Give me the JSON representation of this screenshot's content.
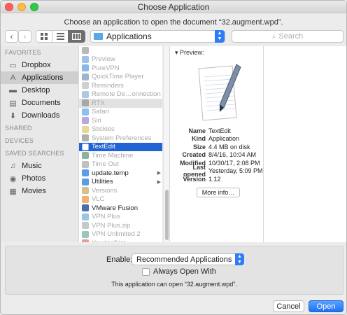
{
  "window": {
    "title": "Choose Application",
    "prompt": "Choose an application to open the document “32.augment.wpd”."
  },
  "toolbar": {
    "location": "Applications",
    "search_placeholder": "Search"
  },
  "sidebar": {
    "sections": [
      {
        "header": "FAVORITES",
        "items": [
          {
            "label": "Dropbox",
            "icon": "dropbox-icon"
          },
          {
            "label": "Applications",
            "icon": "applications-icon",
            "selected": true
          },
          {
            "label": "Desktop",
            "icon": "desktop-icon"
          },
          {
            "label": "Documents",
            "icon": "documents-icon"
          },
          {
            "label": "Downloads",
            "icon": "downloads-icon"
          }
        ]
      },
      {
        "header": "SHARED",
        "items": []
      },
      {
        "header": "DEVICES",
        "items": []
      },
      {
        "header": "SAVED SEARCHES",
        "items": [
          {
            "label": "Music",
            "icon": "music-icon"
          },
          {
            "label": "Photos",
            "icon": "photos-icon"
          },
          {
            "label": "Movies",
            "icon": "movies-icon"
          }
        ]
      }
    ]
  },
  "apps": [
    {
      "label": "",
      "color": "#b9b9b9"
    },
    {
      "label": "Preview",
      "color": "#9ec3e6"
    },
    {
      "label": "PureVPN",
      "color": "#87b8e8"
    },
    {
      "label": "QuickTime Player",
      "color": "#9fb5cc"
    },
    {
      "label": "Reminders",
      "color": "#d0d0d0"
    },
    {
      "label": "Remote De…onnection",
      "color": "#b0c8e2"
    },
    {
      "label": "RTX",
      "color": "#a8a8a8",
      "highlight": true
    },
    {
      "label": "Safari",
      "color": "#8cc0f0"
    },
    {
      "label": "Siri",
      "color": "#b8a8e0"
    },
    {
      "label": "Stickies",
      "color": "#e8d898"
    },
    {
      "label": "System Preferences",
      "color": "#b0b0b0"
    },
    {
      "label": "TextEdit",
      "color": "#ffffff",
      "selected": true,
      "enabled": true
    },
    {
      "label": "Time Machine",
      "color": "#8fb39a"
    },
    {
      "label": "Time Out",
      "color": "#c0c0c0"
    },
    {
      "label": "update.temp",
      "color": "#5c9ee6",
      "enabled": true,
      "folder": true
    },
    {
      "label": "Utilities",
      "color": "#5c9ee6",
      "enabled": true,
      "folder": true
    },
    {
      "label": "Versions",
      "color": "#d6c08a"
    },
    {
      "label": "VLC",
      "color": "#f0b070"
    },
    {
      "label": "VMware Fusion",
      "color": "#4a6fb0",
      "enabled": true
    },
    {
      "label": "VPN Plus",
      "color": "#98c8e0"
    },
    {
      "label": "VPN Plus.zip",
      "color": "#c8c8c8"
    },
    {
      "label": "VPN Unlimited 2",
      "color": "#9cc8b8"
    },
    {
      "label": "YoudaoDict",
      "color": "#e89a9a"
    }
  ],
  "preview": {
    "header": "Preview:",
    "info": [
      {
        "key": "Name",
        "value": "TextEdit"
      },
      {
        "key": "Kind",
        "value": "Application"
      },
      {
        "key": "Size",
        "value": "4.4 MB on disk"
      },
      {
        "key": "Created",
        "value": "8/4/16, 10:04 AM"
      },
      {
        "key": "Modified",
        "value": "10/30/17, 2:08 PM"
      },
      {
        "key": "Last opened",
        "value": "Yesterday, 5:09 PM"
      },
      {
        "key": "Version",
        "value": "1.12"
      }
    ],
    "more_info": "More info…"
  },
  "options": {
    "enable_label": "Enable:",
    "enable_value": "Recommended Applications",
    "always_open": "Always Open With",
    "note": "This application can open “32.augment.wpd”."
  },
  "buttons": {
    "cancel": "Cancel",
    "open": "Open"
  }
}
